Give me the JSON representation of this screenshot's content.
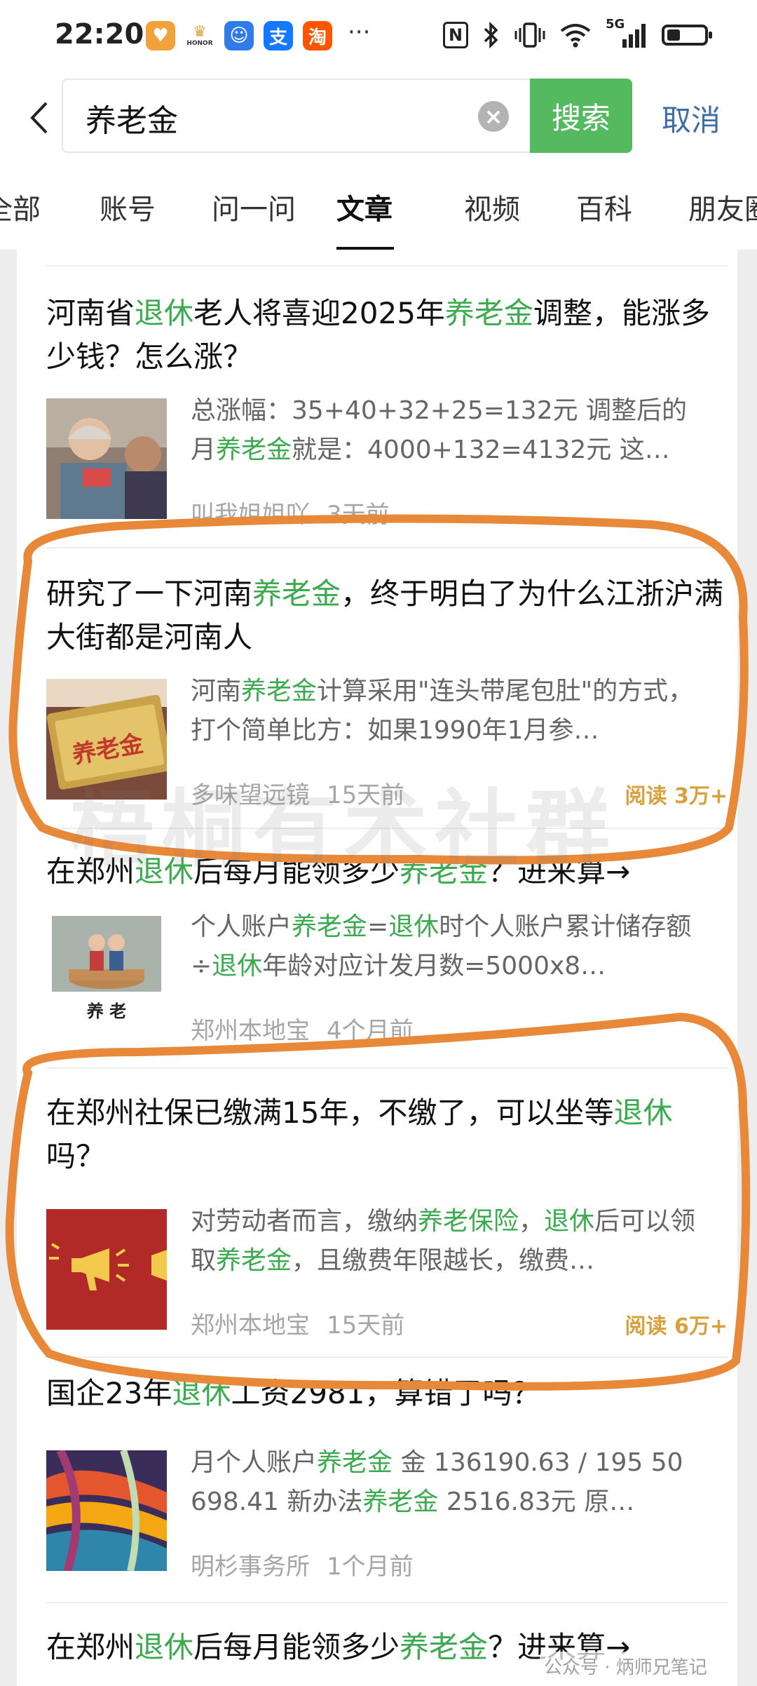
{
  "status_bar": {
    "time": "22:20",
    "overflow": "···",
    "network": "5G",
    "nfc": "N",
    "app_icons": [
      {
        "name": "honor-icon",
        "label": "HONOR"
      },
      {
        "name": "alipay-icon",
        "label": "支"
      },
      {
        "name": "taobao-icon",
        "label": "淘"
      }
    ]
  },
  "search": {
    "query": "养老金",
    "search_button": "搜索",
    "cancel_button": "取消"
  },
  "tabs": [
    {
      "label": "全部"
    },
    {
      "label": "账号"
    },
    {
      "label": "问一问"
    },
    {
      "label": "文章",
      "active": true
    },
    {
      "label": "视频"
    },
    {
      "label": "百科"
    },
    {
      "label": "朋友圈"
    }
  ],
  "results": [
    {
      "title_parts": [
        {
          "t": "河南省",
          "h": false
        },
        {
          "t": "退休",
          "h": true
        },
        {
          "t": "老人将喜迎2025年",
          "h": false
        },
        {
          "t": "养老金",
          "h": true
        },
        {
          "t": "调整，能涨多少钱？怎么涨？",
          "h": false
        }
      ],
      "snippet_parts": [
        {
          "t": "总涨幅：35+40+32+25=132元 调整后的月",
          "h": false
        },
        {
          "t": "养老金",
          "h": true
        },
        {
          "t": "就是：4000+132=4132元 这…",
          "h": false
        }
      ],
      "source": "叫我姐姐吖",
      "time": "3天前",
      "reads": ""
    },
    {
      "title_parts": [
        {
          "t": "研究了一下河南",
          "h": false
        },
        {
          "t": "养老金",
          "h": true
        },
        {
          "t": "，终于明白了为什么江浙沪满大街都是河南人",
          "h": false
        }
      ],
      "snippet_parts": [
        {
          "t": "河南",
          "h": false
        },
        {
          "t": "养老金",
          "h": true
        },
        {
          "t": "计算采用\"连头带尾包肚\"的方式，打个简单比方：如果1990年1月参…",
          "h": false
        }
      ],
      "thumb_text": "养老金",
      "source": "多味望远镜",
      "time": "15天前",
      "reads": "阅读 3万+"
    },
    {
      "title_parts": [
        {
          "t": "在郑州",
          "h": false
        },
        {
          "t": "退休",
          "h": true
        },
        {
          "t": "后每月能领多少",
          "h": false
        },
        {
          "t": "养老金",
          "h": true
        },
        {
          "t": "？进来算→",
          "h": false
        }
      ],
      "snippet_parts": [
        {
          "t": "个人账户",
          "h": false
        },
        {
          "t": "养老金",
          "h": true
        },
        {
          "t": "=",
          "h": false
        },
        {
          "t": "退休",
          "h": true
        },
        {
          "t": "时个人账户累计储存额÷",
          "h": false
        },
        {
          "t": "退休",
          "h": true
        },
        {
          "t": "年龄对应计发月数=5000x8…",
          "h": false
        }
      ],
      "thumb_text": "养 老",
      "source": "郑州本地宝",
      "time": "4个月前",
      "reads": ""
    },
    {
      "title_parts": [
        {
          "t": "在郑州社保已缴满15年，不缴了，可以坐等",
          "h": false
        },
        {
          "t": "退休",
          "h": true
        },
        {
          "t": "吗？",
          "h": false
        }
      ],
      "snippet_parts": [
        {
          "t": "对劳动者而言，缴纳",
          "h": false
        },
        {
          "t": "养老保险",
          "h": true
        },
        {
          "t": "，",
          "h": false
        },
        {
          "t": "退休",
          "h": true
        },
        {
          "t": "后可以领取",
          "h": false
        },
        {
          "t": "养老金",
          "h": true
        },
        {
          "t": "，且缴费年限越长，缴费…",
          "h": false
        }
      ],
      "source": "郑州本地宝",
      "time": "15天前",
      "reads": "阅读 6万+"
    },
    {
      "title_parts": [
        {
          "t": "国企23年",
          "h": false
        },
        {
          "t": "退休",
          "h": true
        },
        {
          "t": "工资2981，算错了吗？",
          "h": false
        }
      ],
      "snippet_parts": [
        {
          "t": "月个人账户",
          "h": false
        },
        {
          "t": "养老金",
          "h": true
        },
        {
          "t": " 金 136190.63 / 195 50 698.41 新办法",
          "h": false
        },
        {
          "t": "养老金",
          "h": true
        },
        {
          "t": " 2516.83元 原…",
          "h": false
        }
      ],
      "source": "明杉事务所",
      "time": "1个月前",
      "reads": ""
    },
    {
      "title_parts": [
        {
          "t": "在郑州",
          "h": false
        },
        {
          "t": "退休",
          "h": true
        },
        {
          "t": "后每月能领多少",
          "h": false
        },
        {
          "t": "养老金",
          "h": true
        },
        {
          "t": "？进来算→",
          "h": false
        }
      ],
      "snippet_parts": [],
      "source": "",
      "time": "",
      "reads": ""
    }
  ],
  "watermark": "梧桐有术社群",
  "footer_watermark": "公众号 · 炳师兄笔记",
  "colors": {
    "highlight": "#3caa4f",
    "search_button": "#55b95f",
    "cancel": "#3d6ea9",
    "reads": "#d9a13c",
    "annotation": "#e8893a"
  }
}
